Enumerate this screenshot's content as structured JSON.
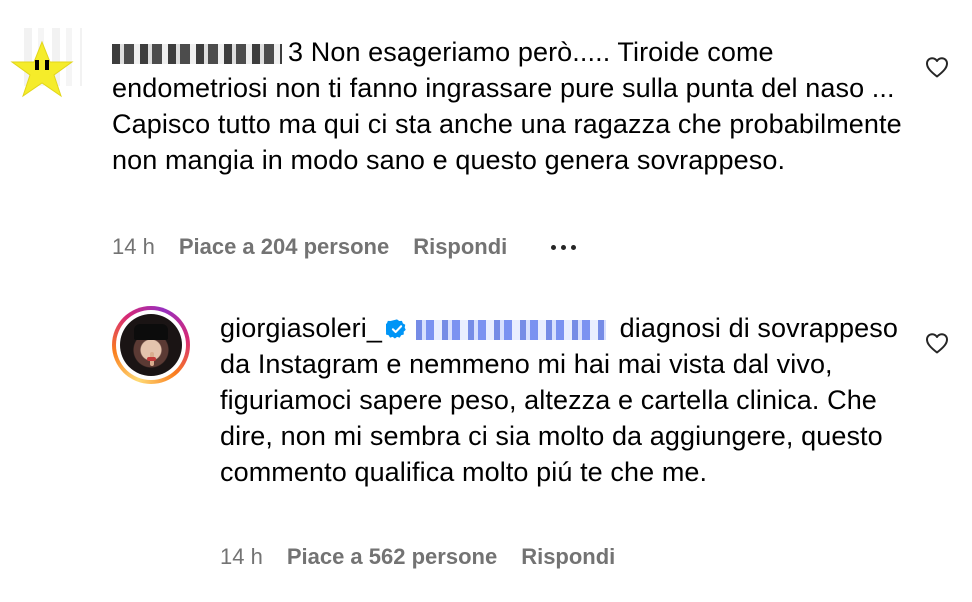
{
  "comments": [
    {
      "avatar": "star-avatar",
      "username_suffix": "3",
      "text": "Non esageriamo però..... Tiroide come endometriosi non ti fanno ingrassare pure sulla punta del naso ... Capisco tutto ma qui ci sta anche una ragazza che probabilmente non mangia in modo sano e questo genera sovrappeso.",
      "time": "14 h",
      "likes": "Piace a 204 persone",
      "reply": "Rispondi",
      "more_icon": "more-icon",
      "like_icon": "heart-icon"
    },
    {
      "avatar": "profile-photo",
      "username": "giorgiasoleri_",
      "verified_icon": "verified-badge-icon",
      "text": "diagnosi di sovrappeso da Instagram e nemmeno mi hai mai vista dal vivo, figuriamoci sapere peso, altezza e cartella clinica. Che dire, non mi sembra ci sia molto da aggiungere, questo commento qualifica molto piú te che me.",
      "time": "14 h",
      "likes": "Piace a 562 persone",
      "reply": "Rispondi",
      "like_icon": "heart-icon"
    }
  ],
  "colors": {
    "meta": "#737373",
    "verified": "#0095f6",
    "text": "#000000"
  }
}
